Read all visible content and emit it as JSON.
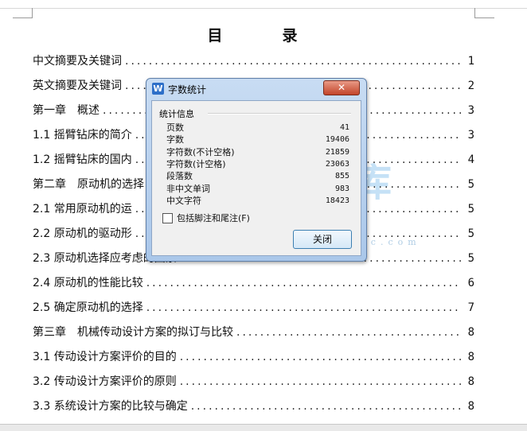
{
  "document": {
    "toc_title": "目　录",
    "entries": [
      {
        "text": "中文摘要及关键词",
        "page": "1"
      },
      {
        "text": "英文摘要及关键词",
        "page": "2"
      },
      {
        "text": "第一章　概述",
        "page": "3"
      },
      {
        "text": "1.1 摇臂钻床的简介",
        "page": "3"
      },
      {
        "text": "1.2 摇臂钻床的国内",
        "page": "4"
      },
      {
        "text": "第二章　原动机的选择",
        "page": "5"
      },
      {
        "text": "2.1 常用原动机的运",
        "page": "5"
      },
      {
        "text": "2.2 原动机的驱动形",
        "page": "5"
      },
      {
        "text": "2.3 原动机选择应考虑的因素",
        "page": "5"
      },
      {
        "text": "2.4 原动机的性能比较",
        "page": "6"
      },
      {
        "text": "2.5 确定原动机的选择",
        "page": "7"
      },
      {
        "text": "第三章　机械传动设计方案的拟订与比较",
        "page": "8"
      },
      {
        "text": "3.1 传动设计方案评价的目的",
        "page": "8"
      },
      {
        "text": "3.2 传动设计方案评价的原则",
        "page": "8"
      },
      {
        "text": "3.3 系统设计方案的比较与确定",
        "page": "8"
      }
    ]
  },
  "dialog": {
    "title": "字数统计",
    "app_icon_letter": "W",
    "close_glyph": "✕",
    "group_label": "统计信息",
    "stats": [
      {
        "label": "页数",
        "value": "41"
      },
      {
        "label": "字数",
        "value": "19406"
      },
      {
        "label": "字符数(不计空格)",
        "value": "21859"
      },
      {
        "label": "字符数(计空格)",
        "value": "23063"
      },
      {
        "label": "段落数",
        "value": "855"
      },
      {
        "label": "非中文单词",
        "value": "983"
      },
      {
        "label": "中文字符",
        "value": "18423"
      }
    ],
    "checkbox_label": "包括脚注和尾注(F)",
    "checkbox_checked": false,
    "close_button_label": "关闭"
  },
  "watermark": {
    "text": "人人文库",
    "url": "www.renrendoc.com"
  }
}
